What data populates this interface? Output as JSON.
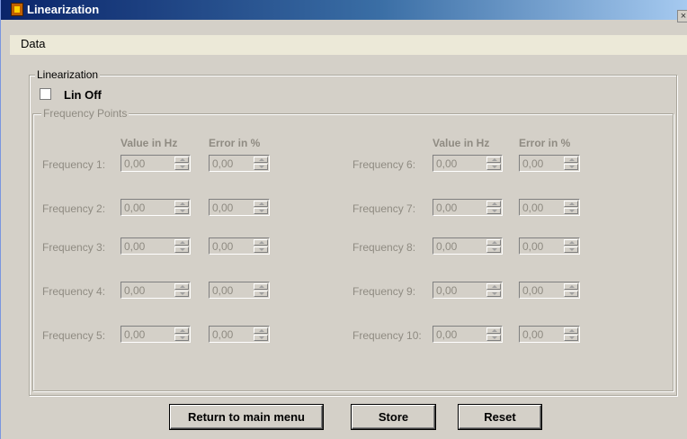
{
  "window": {
    "title": "Linearization",
    "close_glyph": "×"
  },
  "menu": {
    "data_label": "Data"
  },
  "linearization_group": {
    "legend": "Linearization"
  },
  "lin_off": {
    "label": "Lin Off",
    "checked": false
  },
  "freq_group": {
    "legend": "Frequency Points"
  },
  "columns": {
    "value_header": "Value in Hz",
    "error_header": "Error in %"
  },
  "frequencies": [
    {
      "label": "Frequency 1:",
      "value": "0,00",
      "error": "0,00"
    },
    {
      "label": "Frequency 2:",
      "value": "0,00",
      "error": "0,00"
    },
    {
      "label": "Frequency 3:",
      "value": "0,00",
      "error": "0,00"
    },
    {
      "label": "Frequency 4:",
      "value": "0,00",
      "error": "0,00"
    },
    {
      "label": "Frequency 5:",
      "value": "0,00",
      "error": "0,00"
    },
    {
      "label": "Frequency 6:",
      "value": "0,00",
      "error": "0,00"
    },
    {
      "label": "Frequency 7:",
      "value": "0,00",
      "error": "0,00"
    },
    {
      "label": "Frequency 8:",
      "value": "0,00",
      "error": "0,00"
    },
    {
      "label": "Frequency 9:",
      "value": "0,00",
      "error": "0,00"
    },
    {
      "label": "Frequency 10:",
      "value": "0,00",
      "error": "0,00"
    }
  ],
  "buttons": {
    "return_label": "Return to main menu",
    "store_label": "Store",
    "reset_label": "Reset"
  }
}
